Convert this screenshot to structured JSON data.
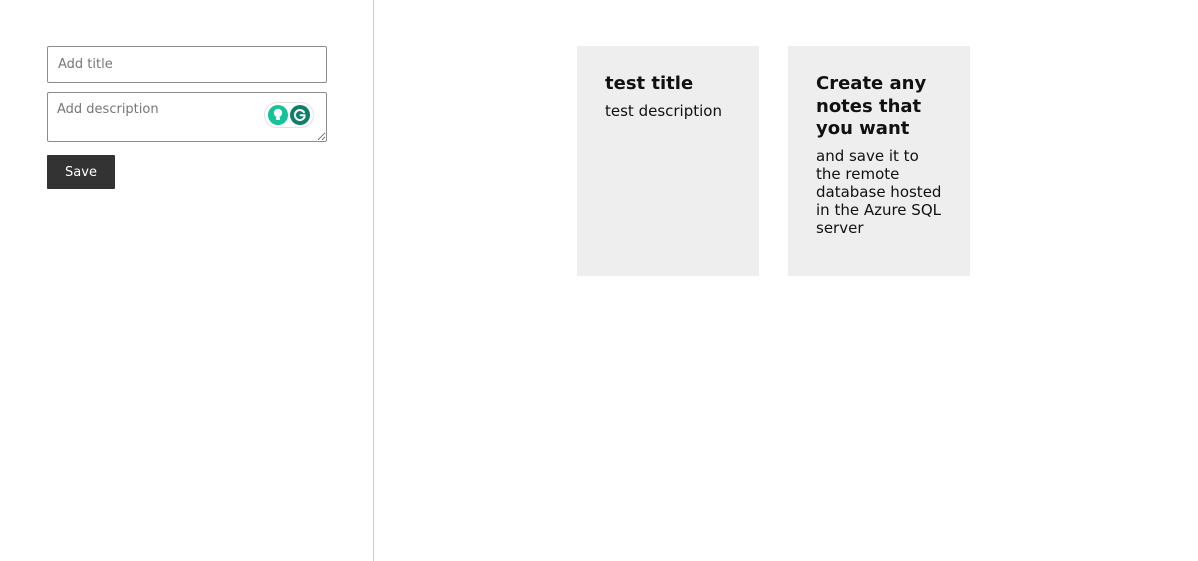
{
  "form": {
    "title_placeholder": "Add title",
    "title_value": "",
    "description_placeholder": "Add description",
    "description_value": "",
    "save_label": "Save"
  },
  "notes": [
    {
      "title": "test title",
      "description": "test description"
    },
    {
      "title": "Create any notes that you want",
      "description": "and save it to the remote database hosted in the Azure SQL server"
    }
  ],
  "colors": {
    "button_bg": "#333333",
    "note_bg": "#eeeeee",
    "grammarly_bulb": "#15c39a",
    "grammarly_logo": "#0f7f6a"
  },
  "icons": {
    "grammarly_suggestion": "lightbulb-icon",
    "grammarly_logo": "grammarly-logo-icon"
  }
}
